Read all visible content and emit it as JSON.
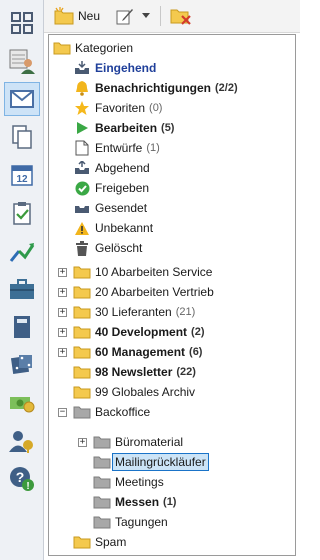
{
  "toolbar": {
    "new_label": "Neu"
  },
  "sidebar": {
    "items": [
      {
        "name": "grid-icon"
      },
      {
        "name": "contacts-icon"
      },
      {
        "name": "mail-icon",
        "active": true
      },
      {
        "name": "documents-icon"
      },
      {
        "name": "calendar-icon",
        "text": "12"
      },
      {
        "name": "tasks-icon"
      },
      {
        "name": "workflow-icon"
      },
      {
        "name": "briefcase-icon"
      },
      {
        "name": "notebook-icon"
      },
      {
        "name": "dice-icon"
      },
      {
        "name": "money-icon"
      },
      {
        "name": "users-icon"
      },
      {
        "name": "help-icon"
      }
    ]
  },
  "tree": {
    "root": {
      "label": "Kategorien"
    },
    "system": [
      {
        "label": "Eingehend",
        "count": "",
        "icon": "inbox-icon"
      },
      {
        "label": "Benachrichtigungen",
        "count": "(2/2)",
        "icon": "bell-icon"
      },
      {
        "label": "Favoriten",
        "count": "(0)",
        "icon": "star-icon"
      },
      {
        "label": "Bearbeiten",
        "count": "(5)",
        "icon": "play-icon"
      },
      {
        "label": "Entwürfe",
        "count": "(1)",
        "icon": "draft-icon"
      },
      {
        "label": "Abgehend",
        "count": "",
        "icon": "outbox-icon"
      },
      {
        "label": "Freigeben",
        "count": "",
        "icon": "check-icon"
      },
      {
        "label": "Gesendet",
        "count": "",
        "icon": "sent-icon"
      },
      {
        "label": "Unbekannt",
        "count": "",
        "icon": "warning-icon"
      },
      {
        "label": "Gelöscht",
        "count": "",
        "icon": "trash-icon"
      }
    ],
    "folders": [
      {
        "label": "10 Abarbeiten Service",
        "count": ""
      },
      {
        "label": "20 Abarbeiten Vertrieb",
        "count": ""
      },
      {
        "label": "30 Lieferanten",
        "count": "(21)"
      },
      {
        "label": "40 Development",
        "count": "(2)"
      },
      {
        "label": "60 Management",
        "count": "(6)"
      },
      {
        "label": "98 Newsletter",
        "count": "(22)"
      },
      {
        "label": "99 Globales Archiv",
        "count": ""
      },
      {
        "label": "Backoffice",
        "count": ""
      }
    ],
    "backoffice": [
      {
        "label": "Büromaterial",
        "count": ""
      },
      {
        "label": "Mailingrückläufer",
        "count": ""
      },
      {
        "label": "Meetings",
        "count": ""
      },
      {
        "label": "Messen",
        "count": "(1)"
      },
      {
        "label": "Tagungen",
        "count": ""
      }
    ],
    "spam": {
      "label": "Spam"
    }
  },
  "colors": {
    "folder_yellow": "#f4c94e",
    "folder_gray": "#9a9a9a",
    "selection_bg": "#cce4f7",
    "selection_border": "#1a73c8",
    "bold_blue": "#1f3f9a"
  }
}
